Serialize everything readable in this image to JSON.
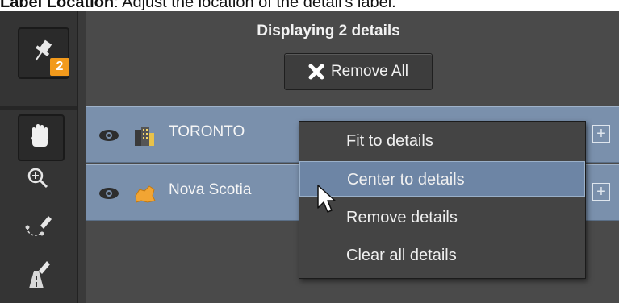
{
  "caption": {
    "bold": "Label Location",
    "text": ": Adjust the location of the detail's label."
  },
  "toolbar": {
    "details_badge": "2",
    "icons": [
      "pin-icon",
      "hand-icon",
      "zoom-in-icon",
      "pen-path-icon",
      "pen-road-icon"
    ]
  },
  "panel": {
    "title": "Displaying 2 details",
    "remove_all_label": "Remove All",
    "rows": [
      {
        "label": "TORONTO",
        "icon": "city-icon"
      },
      {
        "label": "Nova Scotia",
        "icon": "region-icon"
      }
    ]
  },
  "context_menu": {
    "items": [
      {
        "label": "Fit to details"
      },
      {
        "label": "Center to details",
        "highlighted": true
      },
      {
        "label": "Remove details"
      },
      {
        "label": "Clear all details"
      }
    ]
  },
  "colors": {
    "row_bg": "#7a90ac",
    "badge": "#f29a1c",
    "menu_highlight": "#6d85a5",
    "panel_bg": "#4a4a4a"
  }
}
